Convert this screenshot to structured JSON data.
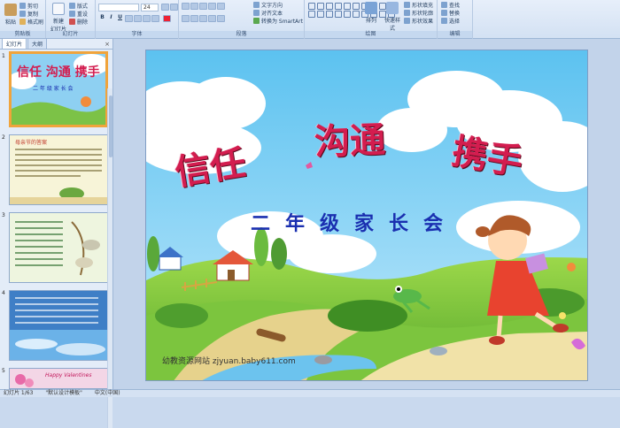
{
  "ribbon": {
    "clipboard": {
      "label": "剪贴板",
      "paste": "粘贴",
      "cut": "剪切",
      "copy": "复制",
      "format_painter": "格式刷"
    },
    "slides": {
      "label": "幻灯片",
      "new_slide": "新建",
      "new_slide2": "幻灯片",
      "layout": "版式",
      "reset": "重设",
      "delete": "删除"
    },
    "font": {
      "label": "字体",
      "size": "24"
    },
    "paragraph": {
      "label": "段落",
      "text_direction": "文字方向",
      "align_text": "对齐文本",
      "smartart": "转换为 SmartArt"
    },
    "drawing": {
      "label": "绘图",
      "arrange": "排列",
      "quick_styles": "快速样式",
      "shape_fill": "形状填充",
      "shape_outline": "形状轮廓",
      "shape_effects": "形状效果"
    },
    "editing": {
      "label": "编辑",
      "find": "查找",
      "replace": "替换",
      "select": "选择"
    }
  },
  "left_pane": {
    "tab_slides": "幻灯片",
    "tab_outline": "大纲",
    "thumbs": [
      {
        "num": "1",
        "title": "信任 沟通 携手",
        "sub": "二 年 级 家 长 会"
      },
      {
        "num": "2",
        "title": "母亲节的答案"
      },
      {
        "num": "3"
      },
      {
        "num": "4"
      },
      {
        "num": "5",
        "title": "Happy Valentines"
      }
    ]
  },
  "slide": {
    "title_chars": [
      "信任",
      "沟通",
      "携手"
    ],
    "subtitle": "二年级家长会",
    "watermark": "幼教资源网站  zjyuan.baby611.com"
  },
  "status": {
    "slide_counter": "幻灯片 1/63",
    "theme": "\"默认设计模板\"",
    "language": "中文(中国)"
  },
  "colors": {
    "title_red": "#d31d4f",
    "subtitle_blue": "#1a2fb0",
    "thumb_active_border": "#f0a43c"
  }
}
